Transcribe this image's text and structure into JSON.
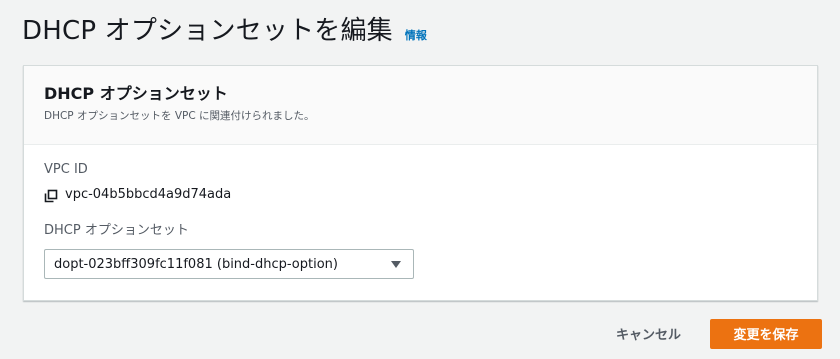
{
  "header": {
    "title": "DHCP オプションセットを編集",
    "info_label": "情報"
  },
  "panel": {
    "title": "DHCP オプションセット",
    "description": "DHCP オプションセットを VPC に関連付けられました。",
    "vpc_id_label": "VPC ID",
    "vpc_id_value": "vpc-04b5bbcd4a9d74ada",
    "vpc_copy_icon": "copy-icon",
    "dhcp_field_label": "DHCP オプションセット",
    "dhcp_selected": "dopt-023bff309fc11f081 (bind-dhcp-option)",
    "select_icon": "caret-down-icon"
  },
  "actions": {
    "cancel_label": "キャンセル",
    "save_label": "変更を保存"
  },
  "colors": {
    "primary": "#ec7211",
    "link": "#0073bb",
    "background": "#f2f3f3"
  }
}
